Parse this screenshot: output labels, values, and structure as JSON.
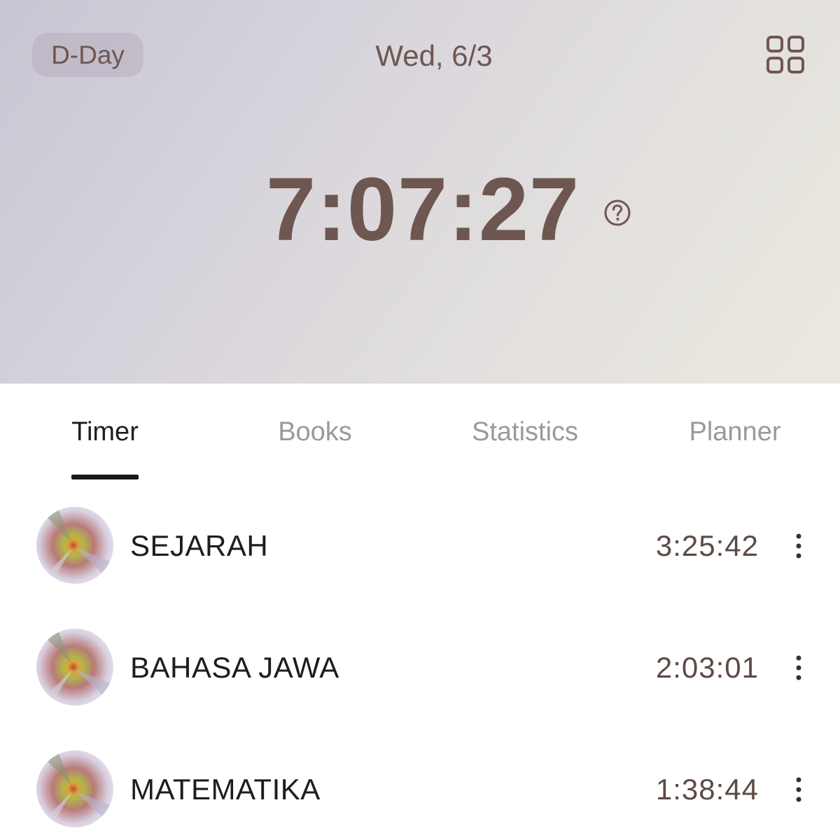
{
  "header": {
    "dday_label": "D-Day",
    "date": "Wed, 6/3",
    "grid_icon": "grid-icon",
    "total_time": "7:07:27",
    "help_icon": "help-circle-icon"
  },
  "tabs": [
    {
      "label": "Timer",
      "active": true
    },
    {
      "label": "Books",
      "active": false
    },
    {
      "label": "Statistics",
      "active": false
    },
    {
      "label": "Planner",
      "active": false
    }
  ],
  "subjects": [
    {
      "name": "SEJARAH",
      "time": "3:25:42"
    },
    {
      "name": "BAHASA JAWA",
      "time": "2:03:01"
    },
    {
      "name": "MATEMATIKA",
      "time": "1:38:44"
    }
  ],
  "colors": {
    "text_brown": "#6e5750",
    "active_tab": "#1e1e1e",
    "inactive_tab": "#9a9a9a"
  }
}
